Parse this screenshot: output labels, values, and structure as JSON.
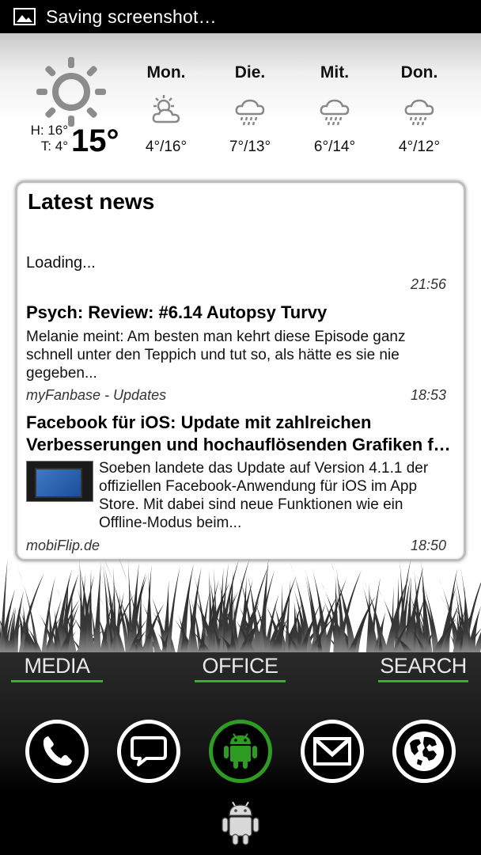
{
  "status_bar": {
    "text": "Saving screenshot…",
    "icon": "image-icon"
  },
  "weather": {
    "current": {
      "high": "H: 16°",
      "low": "T: 4°",
      "temp": "15°",
      "icon": "sun-icon"
    },
    "forecast": [
      {
        "day": "Mon.",
        "temp": "4°/16°",
        "icon": "partly-sunny-icon"
      },
      {
        "day": "Die.",
        "temp": "7°/13°",
        "icon": "rain-cloud-icon"
      },
      {
        "day": "Mit.",
        "temp": "6°/14°",
        "icon": "rain-cloud-icon"
      },
      {
        "day": "Don.",
        "temp": "4°/12°",
        "icon": "rain-cloud-icon"
      }
    ]
  },
  "news": {
    "title": "Latest news",
    "loading": "Loading...",
    "loading_time": "21:56",
    "items": [
      {
        "title": "Psych: Review: #6.14 Autopsy Turvy",
        "body_lines": [
          "Melanie meint: Am besten man kehrt diese Episode ganz",
          "schnell unter den Teppich und tut so, als hätte es sie nie",
          "gegeben..."
        ],
        "source": "myFanbase - Updates",
        "time": "18:53"
      },
      {
        "title_lines": [
          "Facebook für iOS: Update mit zahlreichen",
          "Verbesserungen und hochauflösenden Grafiken f…"
        ],
        "body_lines": [
          "Soeben landete das Update auf Version 4.1.1 der",
          "offiziellen Facebook-Anwendung für iOS im App",
          "Store. Mit dabei sind neue Funktionen wie ein",
          "Offline-Modus beim..."
        ],
        "source": "mobiFlip.de",
        "time": "18:50"
      }
    ]
  },
  "categories": [
    "MEDIA",
    "OFFICE",
    "SEARCH"
  ],
  "dock": [
    {
      "name": "phone-icon"
    },
    {
      "name": "message-icon"
    },
    {
      "name": "android-icon",
      "active": true
    },
    {
      "name": "gmail-icon"
    },
    {
      "name": "globe-icon"
    }
  ],
  "colors": {
    "accent": "#3cae2e",
    "active_ring": "#2e9b22"
  }
}
